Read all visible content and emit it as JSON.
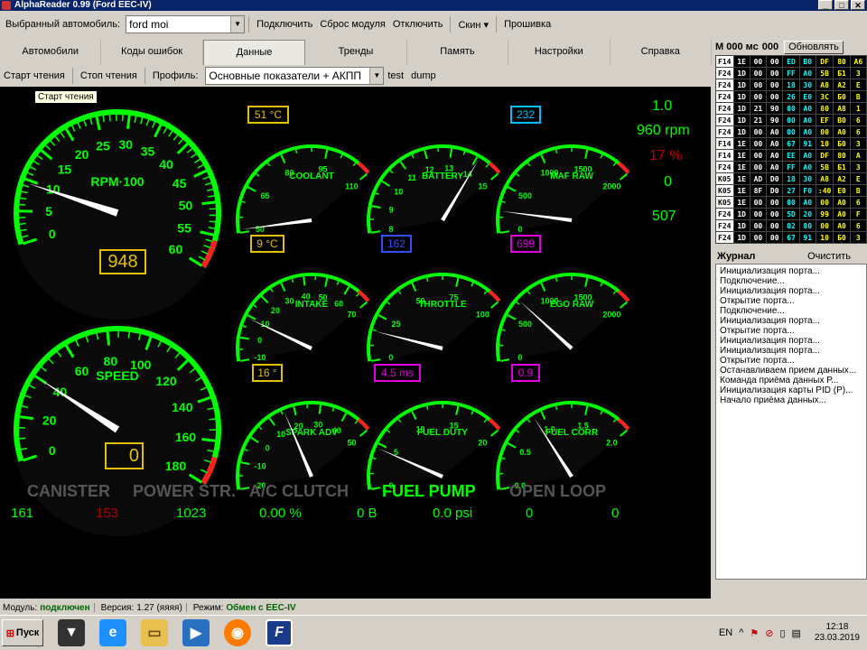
{
  "window": {
    "title": "AlphaReader 0.99 (Ford EEC-IV)"
  },
  "toolbar": {
    "car_label": "Выбранный автомобиль:",
    "car_value": "ford moi",
    "connect": "Подключить",
    "reset": "Сброс модуля",
    "disconnect": "Отключить",
    "skin": "Скин",
    "firmware": "Прошивка"
  },
  "tabs": [
    "Автомобили",
    "Коды ошибок",
    "Данные",
    "Тренды",
    "Память",
    "Настройки",
    "Справка"
  ],
  "active_tab": "Данные",
  "toolbar2": {
    "start": "Старт чтения",
    "stop": "Стоп чтения",
    "profile_label": "Профиль:",
    "profile_value": "Основные показатели + АКПП",
    "test": "test",
    "dump": "dump"
  },
  "tooltip": "Старт чтения",
  "gauges": {
    "rpm": {
      "label": "RPM·100",
      "ticks": [
        "0",
        "5",
        "10",
        "15",
        "20",
        "25",
        "30",
        "35",
        "40",
        "45",
        "50",
        "55",
        "60"
      ],
      "min": 0,
      "max": 60,
      "value": 9.48,
      "readout": "948"
    },
    "speed": {
      "label": "SPEED",
      "ticks": [
        "0",
        "20",
        "40",
        "60",
        "80",
        "100",
        "120",
        "140",
        "160",
        "180"
      ],
      "min": 0,
      "max": 180,
      "value": 40,
      "readout": "0"
    },
    "coolant": {
      "label": "COOLANT",
      "ticks": [
        "50",
        "65",
        "80",
        "95",
        "110"
      ],
      "min": 50,
      "max": 110,
      "value": 51,
      "readout": "51 °C"
    },
    "battery": {
      "label": "BATTERY",
      "ticks": [
        "8",
        "9",
        "10",
        "11",
        "12",
        "13",
        "14",
        "15"
      ],
      "min": 8,
      "max": 15,
      "value": 14.1,
      "readout": ""
    },
    "maf": {
      "label": "MAF RAW",
      "ticks": [
        "0",
        "500",
        "1000",
        "1500",
        "2000"
      ],
      "min": 0,
      "max": 2000,
      "value": 232,
      "readout": "232"
    },
    "intake": {
      "label": "INTAKE",
      "ticks": [
        "-10",
        "0",
        "10",
        "20",
        "30",
        "40",
        "50",
        "60",
        "70"
      ],
      "min": -10,
      "max": 70,
      "value": 9,
      "readout": "9 °C"
    },
    "throttle": {
      "label": "THROTTLE",
      "ticks": [
        "0",
        "25",
        "50",
        "75",
        "100"
      ],
      "min": 0,
      "max": 100,
      "value": 16.2,
      "readout": "162"
    },
    "ego": {
      "label": "EGO RAW",
      "ticks": [
        "0",
        "500",
        "1000",
        "1500",
        "2000"
      ],
      "min": 0,
      "max": 2000,
      "value": 699,
      "readout": "699"
    },
    "spark": {
      "label": "SPARK ADV",
      "ticks": [
        "-20",
        "-10",
        "0",
        "10",
        "20",
        "30",
        "40",
        "50"
      ],
      "min": -20,
      "max": 50,
      "value": 16,
      "readout": "16 °"
    },
    "fuelduty": {
      "label": "FUEL DUTY",
      "ticks": [
        "0",
        "5",
        "10",
        "15",
        "20"
      ],
      "min": 0,
      "max": 20,
      "value": 4.5,
      "readout": "4.5 ms"
    },
    "fuelcorr": {
      "label": "FUEL CORR",
      "ticks": [
        "0.0",
        "0.5",
        "1.0",
        "1.5",
        "2.0"
      ],
      "min": 0,
      "max": 2,
      "value": 0.9,
      "readout": "0.9"
    }
  },
  "side_values": [
    "1.0",
    "960 rpm",
    "17 %",
    "0",
    "507"
  ],
  "indicators": [
    {
      "label": "CANISTER",
      "on": false
    },
    {
      "label": "POWER STR.",
      "on": false
    },
    {
      "label": "A/C CLUTCH",
      "on": false
    },
    {
      "label": "FUEL PUMP",
      "on": true
    },
    {
      "label": "OPEN LOOP",
      "on": false
    }
  ],
  "bottom_values": [
    "161",
    "153",
    "1023",
    "0.00 %",
    "0 В",
    "0.0 psi",
    "0",
    "0"
  ],
  "monitor": {
    "label": "M 000 мс",
    "count": "000",
    "refresh": "Обновлять"
  },
  "hex_rows": [
    [
      "F14",
      "1E",
      "00",
      "00",
      "ED",
      "B0",
      "DF",
      "80",
      "A6"
    ],
    [
      "F24",
      "1D",
      "00",
      "00",
      "FF",
      "A0",
      "5B",
      "Б1",
      "3"
    ],
    [
      "F24",
      "1D",
      "00",
      "00",
      "18",
      "30",
      "A8",
      "A2",
      "E"
    ],
    [
      "F24",
      "1D",
      "00",
      "00",
      "26",
      "E0",
      "3C",
      "Б0",
      "B"
    ],
    [
      "F24",
      "1D",
      "21",
      "90",
      "00",
      "A0",
      "80",
      "A8",
      "1"
    ],
    [
      "F24",
      "1D",
      "21",
      "90",
      "00",
      "A0",
      "EF",
      "B0",
      "6"
    ],
    [
      "F24",
      "1D",
      "00",
      "A0",
      "00",
      "A0",
      "00",
      "A0",
      "6"
    ],
    [
      "F14",
      "1E",
      "00",
      "A0",
      "67",
      "91",
      "10",
      "Б0",
      "3"
    ],
    [
      "F14",
      "1E",
      "00",
      "A0",
      "EE",
      "A0",
      "DF",
      "80",
      "A"
    ],
    [
      "F24",
      "1E",
      "00",
      "A0",
      "FF",
      "A0",
      "5B",
      "Б1",
      "3"
    ],
    [
      "K05",
      "1E",
      "AD",
      "D0",
      "18",
      "30",
      "A8",
      "A2",
      "E"
    ],
    [
      "K05",
      "1E",
      "8F",
      "D0",
      "27",
      "F0",
      ":40",
      "E0",
      "B"
    ],
    [
      "K05",
      "1E",
      "00",
      "00",
      "00",
      "A0",
      "00",
      "A0",
      "6"
    ],
    [
      "F24",
      "1D",
      "00",
      "00",
      "5D",
      "20",
      "99",
      "A0",
      "F"
    ],
    [
      "F24",
      "1D",
      "00",
      "00",
      "02",
      "80",
      "00",
      "A0",
      "6"
    ],
    [
      "F24",
      "1D",
      "00",
      "00",
      "67",
      "91",
      "10",
      "Б0",
      "3"
    ]
  ],
  "log": {
    "label": "Журнал",
    "clear": "Очистить",
    "entries": [
      "Инициализация порта...",
      "Подключение...",
      "Инициализация порта...",
      "Открытие порта...",
      "Подключение...",
      "Инициализация порта...",
      "Открытие порта...",
      "Инициализация порта...",
      "Инициализация порта...",
      "Открытие порта...",
      "Останавливаем прием данных...",
      "Команда приёма данных Р...",
      "Инициализация карты PID (Р)...",
      "Начало приёма данных..."
    ]
  },
  "status": {
    "module_label": "Модуль:",
    "module_value": "подключен",
    "version_label": "Версия:",
    "version_value": "1.27 (яяяя)",
    "mode_label": "Режим:",
    "mode_value": "Обмен с EEC-IV"
  },
  "taskbar": {
    "start": "Пуск",
    "lang": "EN",
    "time": "12:18",
    "date": "23.03.2019"
  },
  "colors": {
    "gauge_green": "#00ff00",
    "redline": "#ff2020",
    "readout_yellow": "#e0c000",
    "readout_cyan": "#00c0ff",
    "readout_blue": "#3050ff",
    "readout_magenta": "#e000e0",
    "hex_yellow": "#ffff00",
    "hex_cyan": "#00ffff",
    "side_red": "#c00000"
  }
}
